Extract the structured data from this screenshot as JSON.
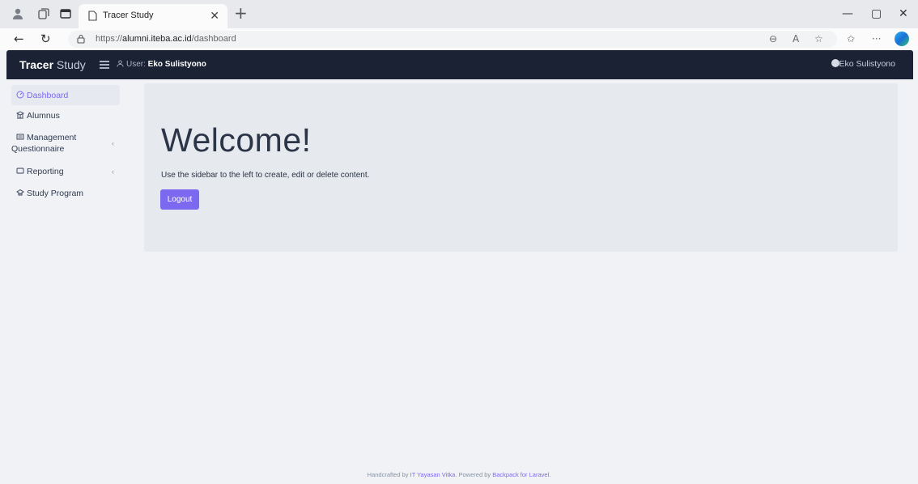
{
  "browser": {
    "tab_title": "Tracer Study",
    "url_prefix": "https://",
    "url_host": "alumni.iteba.ac.id",
    "url_path": "/dashboard",
    "icons": [
      "profile-icon",
      "workspaces-icon",
      "tab-actions-icon",
      "page-icon",
      "close-icon",
      "new-tab-icon",
      "back-icon",
      "refresh-icon",
      "lock-icon",
      "zoom-icon",
      "read-aloud-icon",
      "favorite-icon",
      "favorites-icon",
      "more-icon",
      "copilot-icon",
      "minimize-icon",
      "maximize-icon",
      "window-close-icon"
    ]
  },
  "header": {
    "brand_bold": "Tracer",
    "brand_rest": " Study",
    "user_label": "User: ",
    "user_name": "Eko Sulistyono",
    "account_name": "Eko Sulistyono"
  },
  "sidebar": {
    "items": [
      {
        "label": "Dashboard",
        "icon": "dashboard-icon",
        "active": true
      },
      {
        "label": "Alumnus",
        "icon": "alumnus-icon"
      },
      {
        "label_line1": "Management",
        "label_line2": "Questionnaire",
        "icon": "questionnaire-icon",
        "has_children": true
      },
      {
        "label": "Reporting",
        "icon": "reporting-icon",
        "has_children": true
      },
      {
        "label": "Study Program",
        "icon": "study-program-icon"
      }
    ],
    "chevron": "‹"
  },
  "main": {
    "heading": "Welcome!",
    "intro": "Use the sidebar to the left to create, edit or delete content.",
    "logout_label": "Logout"
  },
  "footer": {
    "prefix": "Handcrafted by ",
    "org": "IT Yayasan Vitka",
    "middle": ". Powered by ",
    "powered": "Backpack for Laravel",
    "suffix": "."
  },
  "colors": {
    "header_bg": "#1a2233",
    "accent": "#7c69ef",
    "content_bg": "#f0f2f5",
    "jumbotron_bg": "#e6e9ee"
  }
}
